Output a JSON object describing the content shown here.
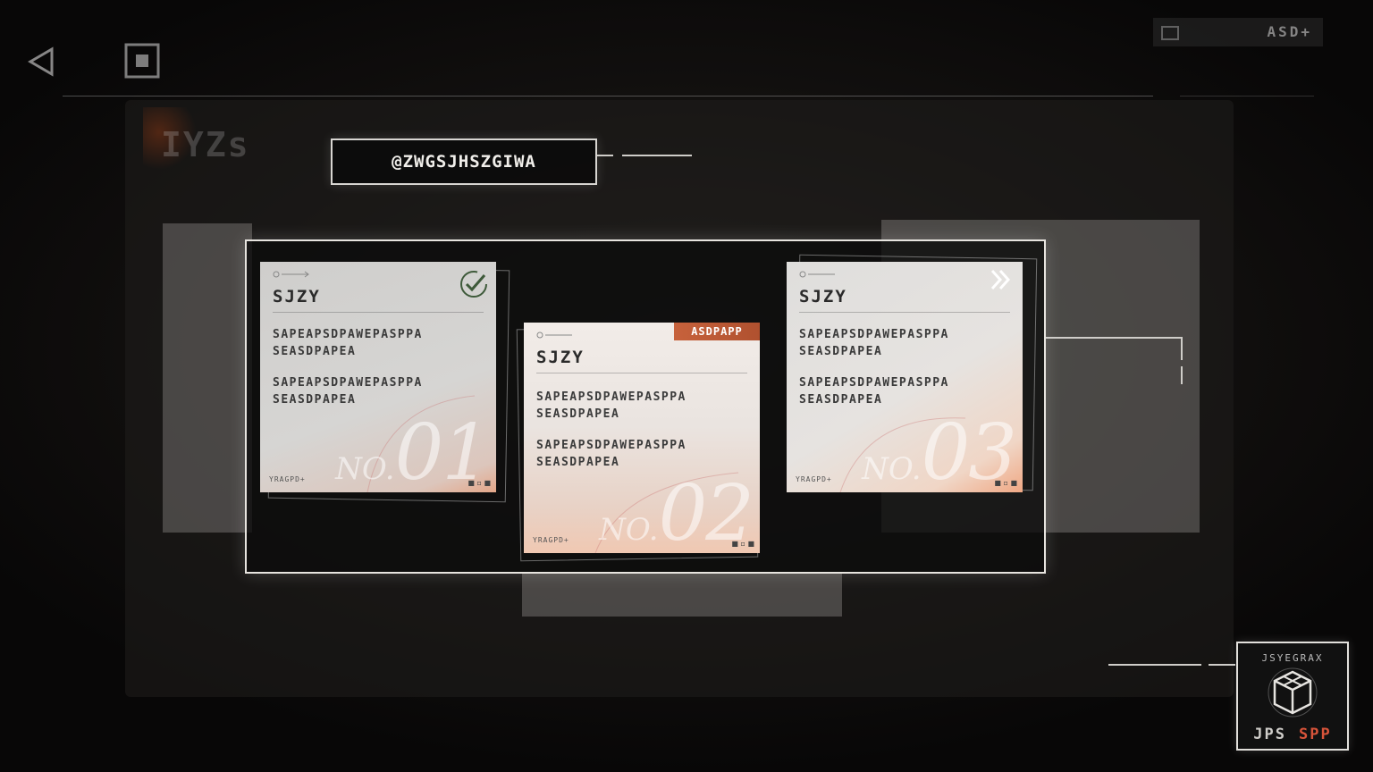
{
  "header": {
    "currency_value": "ASD+",
    "back_icon": "back-triangle-icon",
    "home_icon": "home-square-icon"
  },
  "section": {
    "title": "@ZWGSJHSZGIWA",
    "faded_tab": "IYZs"
  },
  "cards": [
    {
      "title": "SJZY",
      "paragraph_1": "SAPEAPSDPAWEPASPPA SEASDPAPEA",
      "paragraph_2": "SAPEAPSDPAWEPASPPA SEASDPAPEA",
      "no_label": "NO.",
      "number": "01",
      "brand": "YRAGPD+",
      "status_icon": "checkmark-circle-icon",
      "state": "completed"
    },
    {
      "title": "SJZY",
      "paragraph_1": "SAPEAPSDPAWEPASPPA SEASDPAPEA",
      "paragraph_2": "SAPEAPSDPAWEPASPPA SEASDPAPEA",
      "no_label": "NO.",
      "number": "02",
      "brand": "YRAGPD+",
      "badge": "ASDPAPP",
      "state": "badge"
    },
    {
      "title": "SJZY",
      "paragraph_1": "SAPEAPSDPAWEPASPPA SEASDPAPEA",
      "paragraph_2": "SAPEAPSDPAWEPASPPA SEASDPAPEA",
      "no_label": "NO.",
      "number": "03",
      "brand": "YRAGPD+",
      "status_icon": "double-chevron-right-icon",
      "state": "next"
    }
  ],
  "gift": {
    "top_label": "JSYEGRAX",
    "bottom_left": "JPS",
    "bottom_right": "SPP",
    "icon": "gift-box-icon"
  },
  "colors": {
    "accent": "#c7623c",
    "frame": "#e7e4df",
    "background": "#0d0c0b"
  }
}
